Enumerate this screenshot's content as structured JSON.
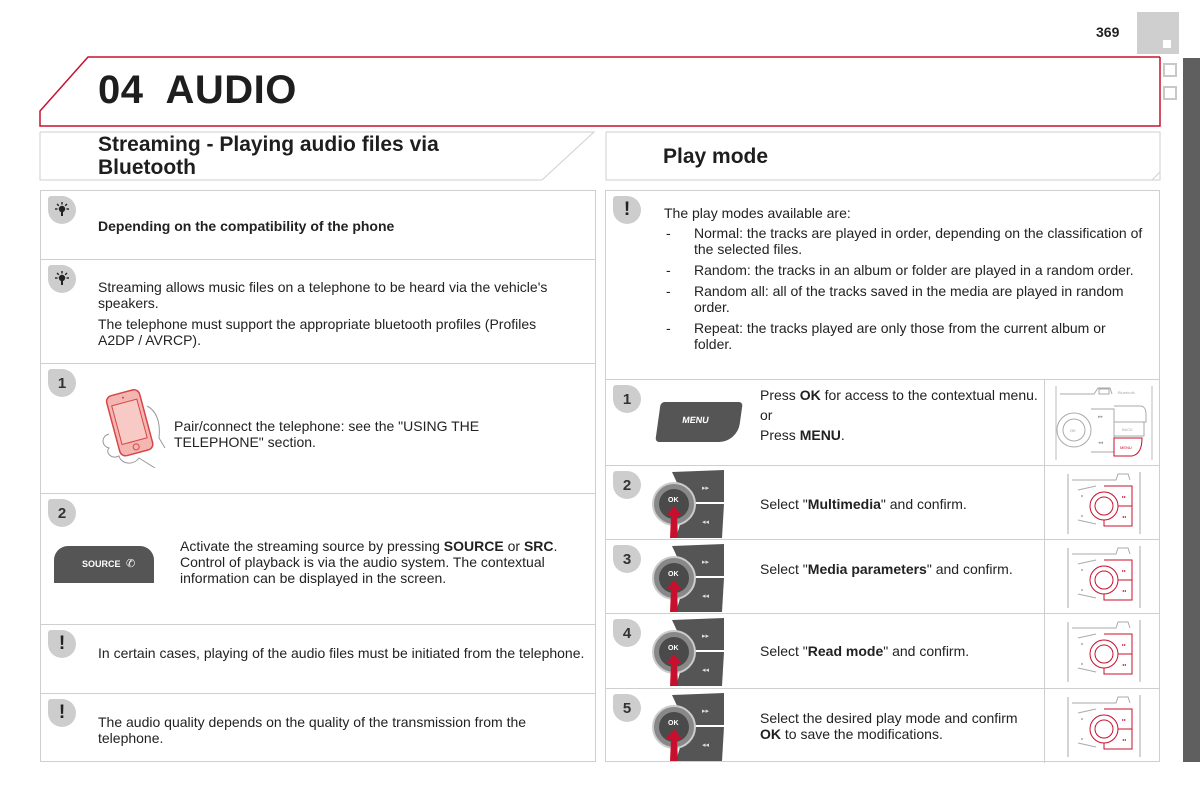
{
  "page": {
    "number": "369",
    "chapter_number": "04",
    "chapter_title": "AUDIO",
    "accent_color": "#c8102e"
  },
  "left": {
    "section_title_line1": "Streaming - Playing audio files via",
    "section_title_line2": "Bluetooth",
    "tip1": {
      "icon": "lightbulb-icon",
      "text": "Depending on the compatibility of the phone"
    },
    "tip2": {
      "icon": "lightbulb-icon",
      "para1": "Streaming allows music files on a telephone to be heard via the vehicle's speakers.",
      "para2": "The telephone must support the appropriate bluetooth profiles (Profiles A2DP / AVRCP)."
    },
    "step1": {
      "number": "1",
      "text": "Pair/connect the telephone: see the \"USING THE TELEPHONE\" section."
    },
    "step2": {
      "number": "2",
      "button_label": "SOURCE",
      "text_pre": "Activate the streaming source by pressing ",
      "bold1": "SOURCE",
      "text_mid": " or ",
      "bold2": "SRC",
      "text_post": ". Control of playback is via the audio system. The contextual information can be displayed in the screen."
    },
    "warning1": {
      "icon": "exclamation-icon",
      "text": "In certain cases, playing of the audio files must be initiated from the telephone."
    },
    "warning2": {
      "icon": "exclamation-icon",
      "text": "The audio quality depends on the quality of the transmission from the telephone."
    }
  },
  "right": {
    "section_title": "Play mode",
    "info": {
      "icon": "exclamation-icon",
      "intro": "The play modes available are:",
      "modes": [
        "Normal: the tracks are played in order, depending on the classification of the selected files.",
        "Random: the tracks in an album or folder are played in a random order.",
        "Random all: all of the tracks saved in the media are played in random order.",
        "Repeat: the tracks played are only those from the current album or folder."
      ]
    },
    "steps": [
      {
        "number": "1",
        "button_label": "MENU",
        "line1_pre": "Press ",
        "line1_bold": "OK",
        "line1_post": " for access to the contextual menu.",
        "line2": "or",
        "line3_pre": "Press ",
        "line3_bold": "MENU",
        "line3_post": "."
      },
      {
        "number": "2",
        "knob_label": "OK",
        "pre": "Select \"",
        "bold": "Multimedia",
        "post": "\" and confirm."
      },
      {
        "number": "3",
        "knob_label": "OK",
        "pre": "Select \"",
        "bold": "Media parameters",
        "post": "\" and confirm."
      },
      {
        "number": "4",
        "knob_label": "OK",
        "pre": "Select \"",
        "bold": "Read mode",
        "post": "\" and confirm."
      },
      {
        "number": "5",
        "knob_label": "OK",
        "pre": "Select the desired play mode and confirm ",
        "bold": "OK",
        "post": " to save the modifications."
      }
    ],
    "console_labels": {
      "ok": "OK",
      "back": "BACK",
      "menu": "MENU",
      "bluetooth": "Bluetooth"
    }
  }
}
